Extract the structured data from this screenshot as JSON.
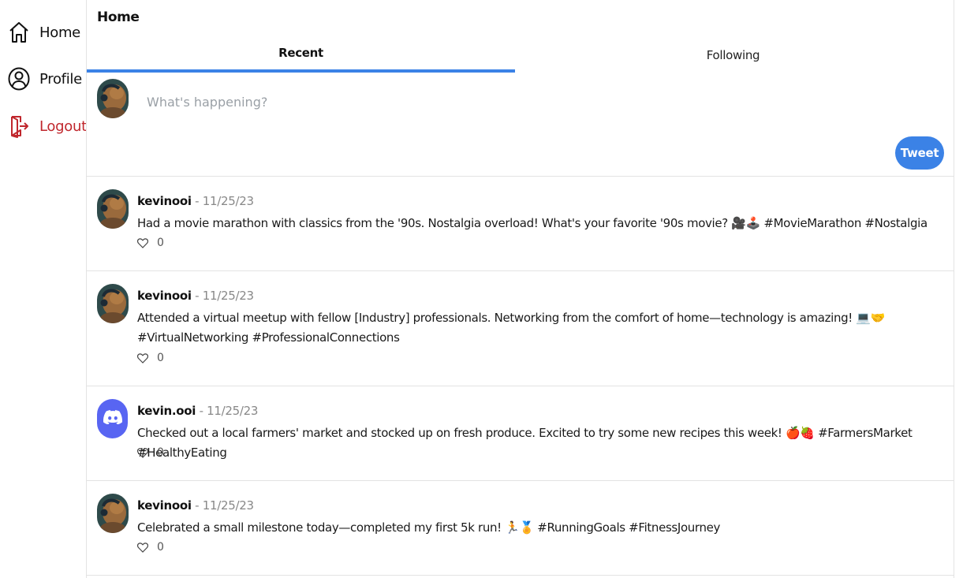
{
  "sidebar": {
    "items": [
      {
        "label": "Home",
        "icon": "home-icon"
      },
      {
        "label": "Profile",
        "icon": "user-circle-icon"
      },
      {
        "label": "Logout",
        "icon": "logout-icon",
        "color": "#c0272d"
      }
    ]
  },
  "header": {
    "title": "Home"
  },
  "tabs": [
    {
      "label": "Recent",
      "active": true
    },
    {
      "label": "Following",
      "active": false
    }
  ],
  "composer": {
    "placeholder": "What's happening?",
    "button_label": "Tweet"
  },
  "colors": {
    "accent": "#3b82e6",
    "logout": "#c0272d",
    "discord": "#5865f2"
  },
  "posts": [
    {
      "author": "kevinooi",
      "separator": "-",
      "date": "11/25/23",
      "text": "Had a movie marathon with classics from the '90s. Nostalgia overload! What's your favorite '90s movie? 🎥🕹️ #MovieMarathon #Nostalgia",
      "likes": "0",
      "avatar": "capybara-avatar"
    },
    {
      "author": "kevinooi",
      "separator": "-",
      "date": "11/25/23",
      "text": "Attended a virtual meetup with fellow [Industry] professionals. Networking from the comfort of home—technology is amazing! 💻🤝 #VirtualNetworking #ProfessionalConnections",
      "likes": "0",
      "avatar": "capybara-avatar"
    },
    {
      "author": "kevin.ooi",
      "separator": "-",
      "date": "11/25/23",
      "text": "Checked out a local farmers' market and stocked up on fresh produce. Excited to try some new recipes this week! 🍎🍓 #FarmersMarket #HealthyEating",
      "likes": "0",
      "avatar": "discord-avatar"
    },
    {
      "author": "kevinooi",
      "separator": "-",
      "date": "11/25/23",
      "text": "Celebrated a small milestone today—completed my first 5k run! 🏃🏅 #RunningGoals #FitnessJourney",
      "likes": "0",
      "avatar": "capybara-avatar"
    }
  ]
}
